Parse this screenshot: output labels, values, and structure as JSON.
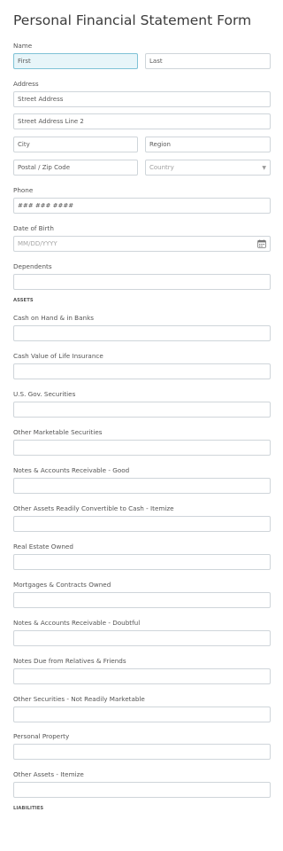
{
  "form": {
    "title": "Personal Financial Statement Form",
    "name": {
      "label": "Name",
      "first_placeholder": "First",
      "last_placeholder": "Last"
    },
    "address": {
      "label": "Address",
      "street_placeholder": "Street Address",
      "street2_placeholder": "Street Address Line 2",
      "city_placeholder": "City",
      "region_placeholder": "Region",
      "postal_placeholder": "Postal / Zip Code",
      "country_placeholder": "Country",
      "chevron_icon": "chevron-down-icon"
    },
    "phone": {
      "label": "Phone",
      "placeholder": "### ### ####"
    },
    "dob": {
      "label": "Date of Birth",
      "placeholder": "MM/DD/YYYY",
      "calendar_icon": "calendar-icon"
    },
    "dependents": {
      "label": "Dependents",
      "value": ""
    },
    "assets": {
      "heading": "ASSETS",
      "fields": [
        {
          "label": "Cash on Hand & in Banks",
          "value": ""
        },
        {
          "label": "Cash Value of Life Insurance",
          "value": ""
        },
        {
          "label": "U.S. Gov. Securities",
          "value": ""
        },
        {
          "label": "Other Marketable Securities",
          "value": ""
        },
        {
          "label": "Notes & Accounts Receivable - Good",
          "value": ""
        },
        {
          "label": "Other Assets Readily Convertible to Cash - Itemize",
          "value": ""
        },
        {
          "label": "Real Estate Owned",
          "value": ""
        },
        {
          "label": "Mortgages & Contracts Owned",
          "value": ""
        },
        {
          "label": "Notes & Accounts Receivable - Doubtful",
          "value": ""
        },
        {
          "label": "Notes Due from Relatives & Friends",
          "value": ""
        },
        {
          "label": "Other Securities - Not Readily Marketable",
          "value": ""
        },
        {
          "label": "Personal Property",
          "value": ""
        },
        {
          "label": "Other Assets - Itemize",
          "value": ""
        }
      ]
    },
    "liabilities": {
      "heading": "LIABILITIES"
    },
    "colors": {
      "focus_border": "#7fc2d6",
      "focus_background": "#e7f5f9",
      "input_border": "#cfd5da"
    }
  }
}
